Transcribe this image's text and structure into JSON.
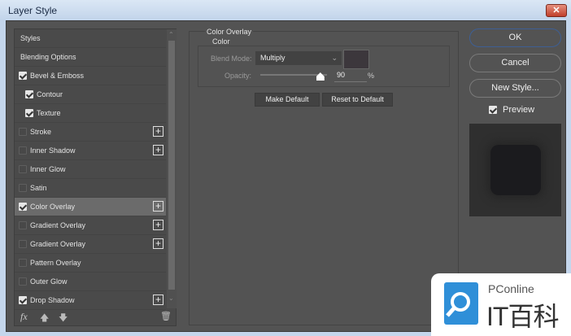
{
  "window": {
    "title": "Layer Style",
    "close": "✕"
  },
  "styles_list": {
    "items": [
      {
        "label": "Styles",
        "checkbox": null,
        "indent": 0,
        "plus": false
      },
      {
        "label": "Blending Options",
        "checkbox": null,
        "indent": 0,
        "plus": false
      },
      {
        "label": "Bevel & Emboss",
        "checkbox": true,
        "indent": 0,
        "plus": false
      },
      {
        "label": "Contour",
        "checkbox": true,
        "indent": 1,
        "plus": false
      },
      {
        "label": "Texture",
        "checkbox": true,
        "indent": 1,
        "plus": false
      },
      {
        "label": "Stroke",
        "checkbox": false,
        "indent": 0,
        "plus": true
      },
      {
        "label": "Inner Shadow",
        "checkbox": false,
        "indent": 0,
        "plus": true
      },
      {
        "label": "Inner Glow",
        "checkbox": false,
        "indent": 0,
        "plus": false
      },
      {
        "label": "Satin",
        "checkbox": false,
        "indent": 0,
        "plus": false
      },
      {
        "label": "Color Overlay",
        "checkbox": true,
        "indent": 0,
        "plus": true,
        "selected": true
      },
      {
        "label": "Gradient Overlay",
        "checkbox": false,
        "indent": 0,
        "plus": true
      },
      {
        "label": "Gradient Overlay",
        "checkbox": false,
        "indent": 0,
        "plus": true
      },
      {
        "label": "Pattern Overlay",
        "checkbox": false,
        "indent": 0,
        "plus": false
      },
      {
        "label": "Outer Glow",
        "checkbox": false,
        "indent": 0,
        "plus": false
      },
      {
        "label": "Drop Shadow",
        "checkbox": true,
        "indent": 0,
        "plus": true
      }
    ],
    "fx_label": "fx"
  },
  "panel": {
    "section": "Color Overlay",
    "group": "Color",
    "blend_mode_label": "Blend Mode:",
    "blend_mode": "Multiply",
    "opacity_label": "Opacity:",
    "opacity": "90",
    "opacity_unit": "%",
    "overlay_color": "#3c373c",
    "make_default": "Make Default",
    "reset_default": "Reset to Default"
  },
  "actions": {
    "ok": "OK",
    "cancel": "Cancel",
    "new_style": "New Style...",
    "preview_label": "Preview",
    "preview_checked": true
  },
  "watermark": {
    "brand": "PConline",
    "name": "IT百科"
  }
}
